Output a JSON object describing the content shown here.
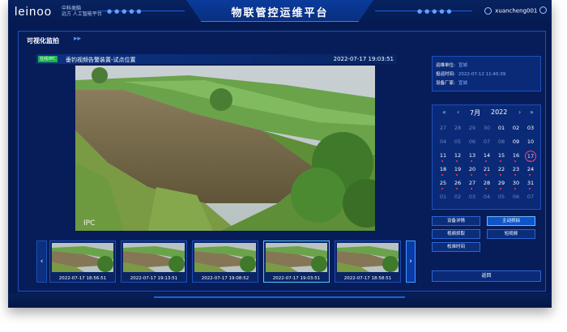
{
  "header": {
    "logo_text": "leinoo",
    "logo_sub_line1": "中科类脑",
    "logo_sub_line2": "远方 人工智能平台",
    "title": "物联管控运维平台",
    "username": "xuancheng001"
  },
  "section": {
    "title": "可视化监拍"
  },
  "camera": {
    "status_badge": "在线/IPC",
    "name": "垂钓视频告警装置-试点位置",
    "timestamp": "2022-07-17 19:03:51",
    "overlay": "IPC"
  },
  "thumbnails": [
    {
      "time": "2022-07-17 18:56:51"
    },
    {
      "time": "2022-07-17 19:13:51"
    },
    {
      "time": "2022-07-17 19:08:52"
    },
    {
      "time": "2022-07-17 19:03:51",
      "selected": true
    },
    {
      "time": "2022-07-17 18:58:51"
    }
  ],
  "info": {
    "unit_label": "运维单位:",
    "unit_value": "宣城",
    "install_label": "投运时间:",
    "install_value": "2022-07-12 11:40:39",
    "vendor_label": "设备厂家:",
    "vendor_value": "宣城"
  },
  "calendar": {
    "prev_year": "«",
    "prev_month": "‹",
    "month": "7月",
    "year": "2022",
    "next_month": "›",
    "next_year": "»",
    "today": 17,
    "days": [
      {
        "d": "27",
        "m": true
      },
      {
        "d": "28",
        "m": true
      },
      {
        "d": "29",
        "m": true
      },
      {
        "d": "30",
        "m": true
      },
      {
        "d": "01"
      },
      {
        "d": "02"
      },
      {
        "d": "03"
      },
      {
        "d": "04",
        "m": true
      },
      {
        "d": "05",
        "m": true
      },
      {
        "d": "06",
        "m": true
      },
      {
        "d": "07",
        "m": true
      },
      {
        "d": "08",
        "m": true
      },
      {
        "d": "09"
      },
      {
        "d": "10"
      },
      {
        "d": "11",
        "dot": true
      },
      {
        "d": "12",
        "dot": true
      },
      {
        "d": "13",
        "dot": true
      },
      {
        "d": "14",
        "dot": true
      },
      {
        "d": "15",
        "dot": true
      },
      {
        "d": "16",
        "dot": true
      },
      {
        "d": "17",
        "dot": true,
        "today": true
      },
      {
        "d": "18",
        "dot": true
      },
      {
        "d": "19",
        "dot": true
      },
      {
        "d": "20",
        "dot": true
      },
      {
        "d": "21",
        "dot": true
      },
      {
        "d": "22",
        "dot": true
      },
      {
        "d": "23",
        "dot": true
      },
      {
        "d": "24",
        "dot": true
      },
      {
        "d": "25",
        "dot": true
      },
      {
        "d": "26",
        "dot": true
      },
      {
        "d": "27",
        "dot": true
      },
      {
        "d": "28",
        "dot": true
      },
      {
        "d": "29",
        "dot": true
      },
      {
        "d": "30",
        "dot": true
      },
      {
        "d": "31",
        "dot": true
      },
      {
        "d": "01",
        "m": true
      },
      {
        "d": "02",
        "m": true
      },
      {
        "d": "03",
        "m": true
      },
      {
        "d": "04",
        "m": true
      },
      {
        "d": "05",
        "m": true
      },
      {
        "d": "06",
        "m": true
      },
      {
        "d": "07",
        "m": true
      }
    ]
  },
  "buttons": {
    "device_detail": "设备详情",
    "active_capture": "主动抓拍",
    "video_capture": "视频抓取",
    "short_video": "短视频",
    "calibrate_time": "校准时间",
    "return": "返回"
  }
}
